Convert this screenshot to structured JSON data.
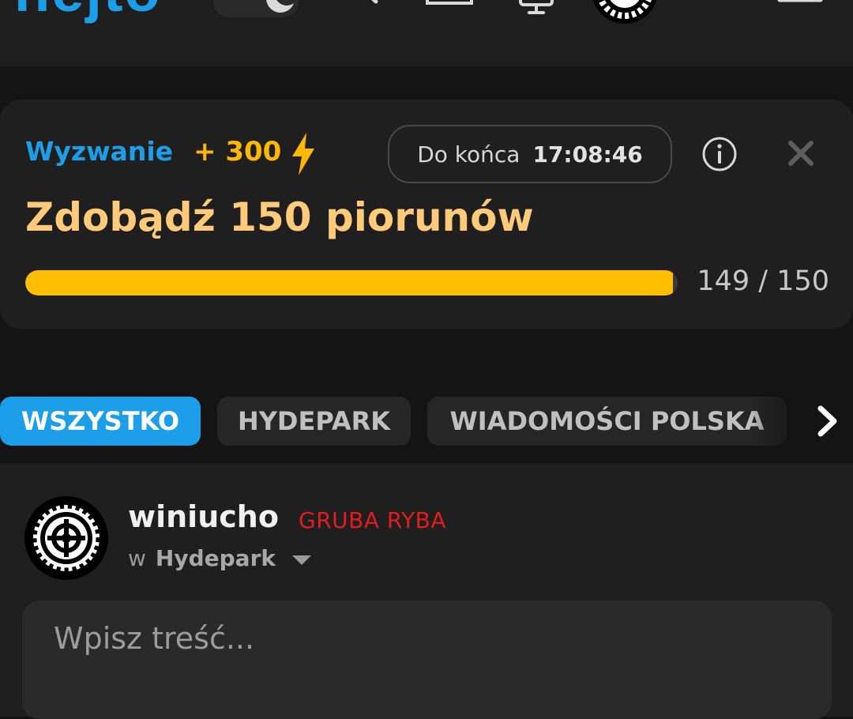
{
  "header": {
    "logo_text": "hejto",
    "icons": [
      "moon-icon",
      "search-icon",
      "inbox-icon",
      "tv-icon",
      "avatar",
      "menu-icon"
    ]
  },
  "challenge": {
    "label": "Wyzwanie",
    "points": "+ 300",
    "timer_label": "Do końca",
    "timer_value": "17:08:46",
    "title": "Zdobądź 150 piorunów",
    "progress_current": 149,
    "progress_total": 150,
    "progress_text": "149 / 150",
    "colors": {
      "accent": "#1c9ee8",
      "points": "#ffb800",
      "title": "#ffcb7a",
      "bar": "#ffbe00"
    }
  },
  "tabs": [
    {
      "label": "WSZYSTKO",
      "active": true
    },
    {
      "label": "HYDEPARK",
      "active": false
    },
    {
      "label": "WIADOMOŚCI POLSKA",
      "active": false
    }
  ],
  "composer": {
    "username": "winiucho",
    "rank": "GRUBA RYBA",
    "channel_prefix": "w",
    "channel": "Hydepark",
    "placeholder": "Wpisz treść...",
    "rank_color": "#e41c1c"
  }
}
